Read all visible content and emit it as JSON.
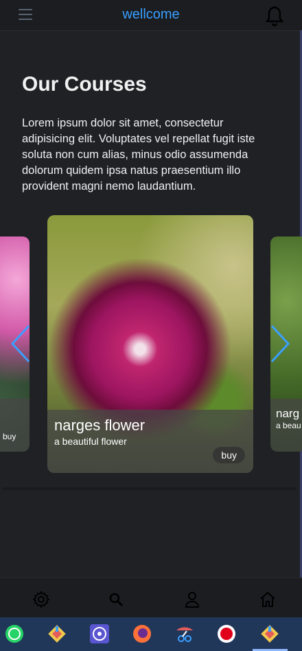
{
  "header": {
    "title": "wellcome",
    "menu_icon": "hamburger-menu-icon",
    "bell_icon": "bell-icon"
  },
  "main": {
    "heading": "Our Courses",
    "intro": "Lorem ipsum dolor sit amet, consectetur adipisicing elit. Voluptates vel repellat fugit iste soluta non cum alias, minus odio assumenda dolorum quidem ipsa natus praesentium illo provident magni nemo laudantium."
  },
  "carousel": {
    "cards": [
      {
        "title": "",
        "subtitle": "",
        "buy": "buy"
      },
      {
        "title": "narges flower",
        "subtitle": "a beautiful flower",
        "buy": "buy"
      },
      {
        "title": "narg",
        "subtitle": "a beau",
        "buy": ""
      }
    ],
    "prev_icon": "chevron-left-icon",
    "next_icon": "chevron-right-icon"
  },
  "bottom_nav": {
    "items": [
      "settings-icon",
      "search-icon",
      "user-icon",
      "home-icon"
    ]
  },
  "taskbar": {
    "apps": [
      "whatsapp-icon",
      "diamond-app-icon",
      "app-icon",
      "firefox-icon",
      "snipping-icon",
      "record-icon",
      "diamond-app-icon"
    ]
  },
  "colors": {
    "accent": "#3b9fff",
    "background": "#1f2125",
    "taskbar": "#21375a"
  }
}
